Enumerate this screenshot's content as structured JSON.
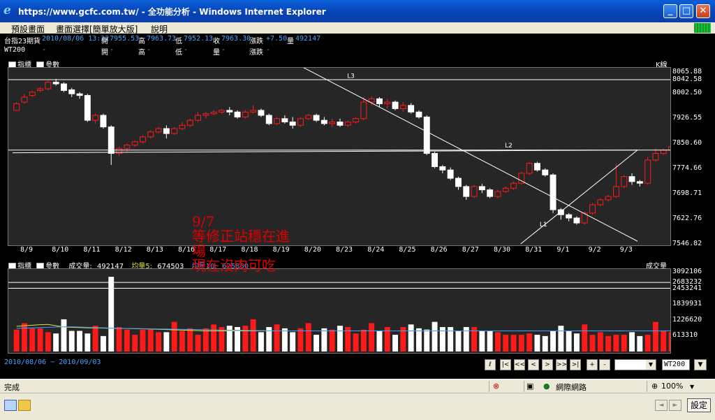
{
  "window": {
    "title": "https://www.gcfc.com.tw/ - 全功能分析 - Windows Internet Explorer",
    "minimize": "_",
    "maximize": "□",
    "close": "✕"
  },
  "menu": [
    "預設畫面",
    "畫面選擇[簡單放大版]",
    "說明"
  ],
  "quote": {
    "name": "台指23期貨",
    "datetime": "2010/08/06 13:32",
    "open_label": "開",
    "open": "7955.53",
    "high_label": "高",
    "high": "7963.73",
    "low_label": "低",
    "low": "7952.13",
    "close_label": "收",
    "close": "7963.30",
    "change_label": "漲跌",
    "change": "+7.50",
    "volume_label": "量",
    "volume": "492147",
    "code": "WT200",
    "dash": "-"
  },
  "price_panel": {
    "indicator_label": "指標",
    "param_label": "參數",
    "kline_label": "K線",
    "trend_labels": [
      "L3",
      "L2",
      "L1"
    ]
  },
  "volume_panel": {
    "indicator_label": "指標",
    "param_label": "參數",
    "vol_label": "成交量:",
    "vol_value": "492147",
    "ma5_label": "均量5:",
    "ma5_value": "674503",
    "ma10_label": "均量10:",
    "ma10_value": "625860",
    "right_label": "成交量"
  },
  "annotation": [
    "9/7",
    "等修正站穩在進",
    "場",
    "現在沒肉可吃"
  ],
  "bottom": {
    "date_range": "2010/08/06 ~ 2010/09/03",
    "nav_buttons": [
      "ℓ",
      "|<",
      "<<",
      "<",
      ">",
      ">>",
      ">|",
      "+",
      "-"
    ],
    "code_value": "WT200",
    "dropdown_arrow": "▼"
  },
  "status": {
    "done": "完成",
    "zone": "網際網路",
    "zoom": "100%",
    "zoom_arrow": "▼"
  },
  "taskbar": {
    "settings": "設定",
    "back": "◄",
    "forward": "►"
  },
  "chart_data": [
    {
      "type": "candlestick",
      "title": "",
      "x_ticks": [
        "8/9",
        "8/10",
        "8/11",
        "8/12",
        "8/13",
        "8/16",
        "8/17",
        "8/18",
        "8/19",
        "8/20",
        "8/23",
        "8/24",
        "8/25",
        "8/26",
        "8/27",
        "8/30",
        "8/31",
        "9/1",
        "9/2",
        "9/3"
      ],
      "y_ticks": [
        8065.88,
        8042.58,
        8002.5,
        7926.55,
        7850.6,
        7774.66,
        7698.71,
        7622.76,
        7546.82
      ],
      "ylim": [
        7546.82,
        8065.88
      ],
      "candles_per_day": 4,
      "colors": {
        "up": "#ff1a1a",
        "down": "#ffffff",
        "background": "#262626"
      },
      "candles": [
        [
          7950,
          7970,
          7955,
          7975
        ],
        [
          7975,
          7990,
          7970,
          8000
        ],
        [
          7995,
          8005,
          7990,
          8010
        ],
        [
          8010,
          8015,
          8005,
          8020
        ],
        [
          8015,
          8035,
          8010,
          8040
        ],
        [
          8035,
          8030,
          8025,
          8045
        ],
        [
          8030,
          8010,
          8005,
          8035
        ],
        [
          8012,
          8000,
          7990,
          8018
        ],
        [
          8000,
          7995,
          7985,
          8005
        ],
        [
          7995,
          7920,
          7915,
          8000
        ],
        [
          7920,
          7935,
          7910,
          7940
        ],
        [
          7935,
          7900,
          7895,
          7940
        ],
        [
          7900,
          7820,
          7785,
          7905
        ],
        [
          7820,
          7835,
          7812,
          7840
        ],
        [
          7835,
          7845,
          7825,
          7850
        ],
        [
          7845,
          7855,
          7840,
          7860
        ],
        [
          7855,
          7870,
          7850,
          7875
        ],
        [
          7870,
          7885,
          7865,
          7890
        ],
        [
          7885,
          7895,
          7880,
          7900
        ],
        [
          7895,
          7880,
          7865,
          7905
        ],
        [
          7880,
          7895,
          7875,
          7900
        ],
        [
          7895,
          7905,
          7890,
          7915
        ],
        [
          7905,
          7920,
          7900,
          7925
        ],
        [
          7920,
          7935,
          7915,
          7945
        ],
        [
          7935,
          7940,
          7925,
          7945
        ],
        [
          7940,
          7945,
          7935,
          7950
        ],
        [
          7945,
          7950,
          7940,
          7955
        ],
        [
          7950,
          7945,
          7935,
          7960
        ],
        [
          7945,
          7930,
          7925,
          7950
        ],
        [
          7930,
          7945,
          7925,
          7950
        ],
        [
          7945,
          7950,
          7940,
          7965
        ],
        [
          7950,
          7935,
          7930,
          7955
        ],
        [
          7935,
          7910,
          7905,
          7940
        ],
        [
          7910,
          7925,
          7905,
          7930
        ],
        [
          7925,
          7915,
          7910,
          7935
        ],
        [
          7915,
          7905,
          7895,
          7930
        ],
        [
          7905,
          7925,
          7900,
          7930
        ],
        [
          7925,
          7935,
          7920,
          7940
        ],
        [
          7935,
          7920,
          7915,
          7940
        ],
        [
          7920,
          7910,
          7905,
          7930
        ],
        [
          7910,
          7915,
          7900,
          7925
        ],
        [
          7915,
          7905,
          7900,
          7925
        ],
        [
          7905,
          7915,
          7900,
          7920
        ],
        [
          7915,
          7925,
          7910,
          7930
        ],
        [
          7925,
          7975,
          7920,
          7990
        ],
        [
          7975,
          7985,
          7965,
          7992
        ],
        [
          7985,
          7970,
          7960,
          7990
        ],
        [
          7970,
          7975,
          7955,
          7985
        ],
        [
          7975,
          7955,
          7950,
          7980
        ],
        [
          7955,
          7965,
          7945,
          7975
        ],
        [
          7965,
          7945,
          7940,
          7972
        ],
        [
          7945,
          7930,
          7925,
          7950
        ],
        [
          7930,
          7820,
          7815,
          7935
        ],
        [
          7820,
          7780,
          7775,
          7825
        ],
        [
          7780,
          7770,
          7760,
          7785
        ],
        [
          7770,
          7745,
          7740,
          7778
        ],
        [
          7745,
          7720,
          7710,
          7750
        ],
        [
          7720,
          7690,
          7680,
          7725
        ],
        [
          7690,
          7720,
          7685,
          7725
        ],
        [
          7720,
          7710,
          7700,
          7728
        ],
        [
          7710,
          7690,
          7685,
          7715
        ],
        [
          7690,
          7705,
          7685,
          7710
        ],
        [
          7705,
          7715,
          7700,
          7720
        ],
        [
          7715,
          7730,
          7710,
          7735
        ],
        [
          7730,
          7760,
          7725,
          7765
        ],
        [
          7760,
          7790,
          7755,
          7795
        ],
        [
          7790,
          7770,
          7765,
          7795
        ],
        [
          7770,
          7755,
          7750,
          7775
        ],
        [
          7755,
          7650,
          7640,
          7760
        ],
        [
          7650,
          7635,
          7620,
          7655
        ],
        [
          7635,
          7625,
          7615,
          7640
        ],
        [
          7625,
          7610,
          7605,
          7630
        ],
        [
          7610,
          7640,
          7605,
          7645
        ],
        [
          7640,
          7665,
          7635,
          7670
        ],
        [
          7665,
          7680,
          7660,
          7685
        ],
        [
          7680,
          7690,
          7675,
          7695
        ],
        [
          7690,
          7720,
          7685,
          7790
        ],
        [
          7720,
          7750,
          7715,
          7755
        ],
        [
          7750,
          7735,
          7725,
          7760
        ],
        [
          7735,
          7730,
          7720,
          7740
        ],
        [
          7730,
          7800,
          7725,
          7810
        ],
        [
          7800,
          7820,
          7795,
          7835
        ],
        [
          7820,
          7830,
          7815,
          7835
        ],
        [
          7830,
          7840,
          7825,
          7845
        ]
      ],
      "horizontal_lines": [
        8042.58,
        7830
      ],
      "trend_lines": [
        {
          "label": "L3",
          "from": [
            9.1,
            8085
          ],
          "to": [
            19.8,
            7555
          ]
        },
        {
          "label": "L2",
          "from": [
            0,
            7822
          ],
          "to": [
            19.8,
            7830
          ]
        },
        {
          "label": "L1",
          "from": [
            16.1,
            7546.82
          ],
          "to": [
            19.8,
            7830
          ]
        }
      ]
    },
    {
      "type": "bar",
      "title": "",
      "y_ticks": [
        3092106,
        2683232,
        2453241,
        1839931,
        1226620,
        613310
      ],
      "ylim": [
        0,
        3092106
      ],
      "horizontal_lines": [
        2683232,
        2453241
      ],
      "series": [
        {
          "name": "成交量",
          "values": [
            850000,
            1100000,
            900000,
            900000,
            750000,
            700000,
            1250000,
            800000,
            800000,
            700000,
            1000000,
            600000,
            2900000,
            950000,
            850000,
            650000,
            850000,
            850000,
            750000,
            750000,
            1150000,
            800000,
            900000,
            650000,
            900000,
            1050000,
            950000,
            1000000,
            950000,
            1000000,
            1250000,
            750000,
            950000,
            1050000,
            900000,
            750000,
            900000,
            1100000,
            650000,
            900000,
            850000,
            1000000,
            950000,
            700000,
            850000,
            1100000,
            800000,
            950000,
            650000,
            950000,
            1050000,
            900000,
            850000,
            1150000,
            950000,
            950000,
            800000,
            950000,
            950000,
            800000,
            800000,
            750000,
            650000,
            650000,
            650000,
            700000,
            650000,
            600000,
            800000,
            1000000,
            800000,
            700000,
            1050000,
            650000,
            750000,
            600000,
            650000,
            650000,
            750000,
            600000,
            650000,
            1150000,
            800000,
            750000,
            750000,
            750000,
            900000,
            700000
          ]
        },
        {
          "name": "均量5",
          "values": [
            980000,
            1000000,
            1020000,
            1040000,
            1050000,
            1000000,
            950000,
            940000,
            930000,
            920000,
            915000,
            910000,
            900000,
            895000,
            890000,
            885000,
            880000,
            870000,
            860000,
            850000,
            840000,
            830000,
            820000,
            810000,
            800000,
            800000,
            800000,
            800000,
            800000,
            800000,
            800000,
            800000,
            800000,
            800000,
            800000,
            800000,
            800000,
            800000,
            800000,
            800000,
            800000,
            800000,
            800000,
            800000,
            800000,
            800000,
            800000,
            800000,
            800000,
            800000,
            800000,
            800000,
            800000,
            800000,
            800000,
            800000,
            800000,
            800000,
            800000,
            800000,
            800000,
            800000,
            800000,
            800000,
            800000,
            800000,
            800000,
            800000,
            800000,
            800000,
            800000,
            800000,
            800000,
            800000,
            800000,
            800000,
            800000,
            800000,
            800000,
            800000,
            800000,
            800000,
            800000,
            800000,
            800000,
            800000,
            800000,
            800000
          ]
        },
        {
          "name": "均量10",
          "values": [
            900000,
            910000,
            920000,
            930000,
            940000,
            950000,
            960000,
            960000,
            950000,
            940000,
            930000,
            920000,
            910000,
            900000,
            895000,
            890000,
            885000,
            880000,
            875000,
            870000,
            865000,
            860000,
            855000,
            850000,
            845000,
            840000,
            835000,
            830000,
            825000,
            820000,
            815000,
            810000,
            805000,
            800000,
            800000,
            800000,
            800000,
            800000,
            800000,
            800000,
            800000,
            800000,
            800000,
            800000,
            800000,
            800000,
            800000,
            800000,
            800000,
            800000,
            800000,
            800000,
            800000,
            800000,
            800000,
            800000,
            800000,
            800000,
            800000,
            800000,
            800000,
            800000,
            800000,
            800000,
            800000,
            800000,
            800000,
            800000,
            800000,
            800000,
            800000,
            800000,
            800000,
            800000,
            800000,
            800000,
            800000,
            800000,
            800000,
            800000,
            800000,
            800000,
            800000,
            800000,
            800000,
            800000,
            800000,
            800000
          ]
        }
      ],
      "colors": {
        "up": "#ff1a1a",
        "down": "#ffffff",
        "ma5": "#e0e040",
        "ma10": "#40a0ff"
      }
    }
  ]
}
